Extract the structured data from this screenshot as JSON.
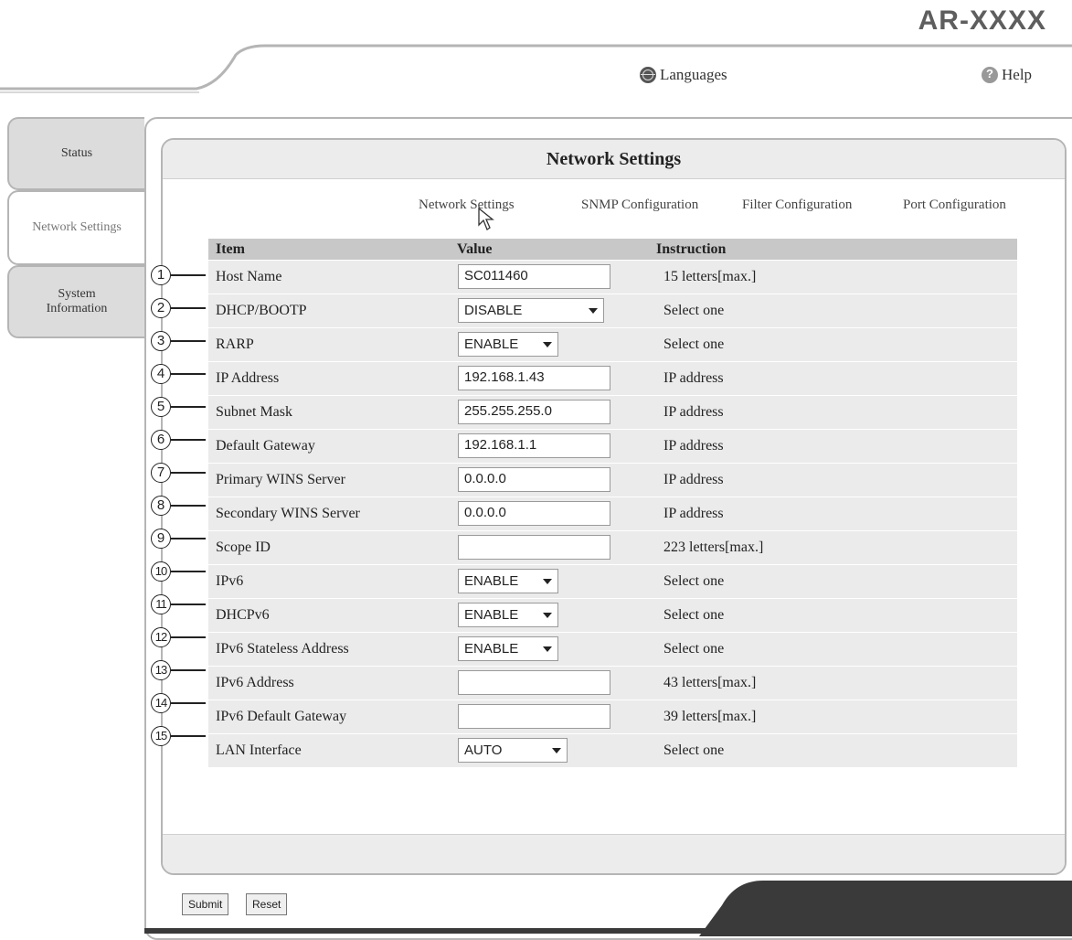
{
  "header": {
    "model": "AR-XXXX",
    "languages_label": "Languages",
    "help_label": "Help"
  },
  "tabs": [
    {
      "label": "Status"
    },
    {
      "label": "Network Settings"
    },
    {
      "label": "System Information"
    }
  ],
  "panel": {
    "title": "Network Settings",
    "subnav": [
      "Network Settings",
      "SNMP Configuration",
      "Filter Configuration",
      "Port Configuration"
    ]
  },
  "table": {
    "headers": {
      "item": "Item",
      "value": "Value",
      "instruction": "Instruction"
    },
    "rows": [
      {
        "num": "1",
        "item": "Host Name",
        "type": "input",
        "value": "SC011460",
        "instruction": "15 letters[max.]"
      },
      {
        "num": "2",
        "item": "DHCP/BOOTP",
        "type": "select",
        "value": "DISABLE",
        "instruction": "Select one"
      },
      {
        "num": "3",
        "item": "RARP",
        "type": "select",
        "value": "ENABLE",
        "instruction": "Select one"
      },
      {
        "num": "4",
        "item": "IP Address",
        "type": "input",
        "value": "192.168.1.43",
        "instruction": "IP address"
      },
      {
        "num": "5",
        "item": "Subnet Mask",
        "type": "input",
        "value": "255.255.255.0",
        "instruction": "IP address"
      },
      {
        "num": "6",
        "item": "Default Gateway",
        "type": "input",
        "value": "192.168.1.1",
        "instruction": "IP address"
      },
      {
        "num": "7",
        "item": "Primary WINS Server",
        "type": "input",
        "value": "0.0.0.0",
        "instruction": "IP address"
      },
      {
        "num": "8",
        "item": "Secondary WINS Server",
        "type": "input",
        "value": "0.0.0.0",
        "instruction": "IP address"
      },
      {
        "num": "9",
        "item": "Scope ID",
        "type": "input",
        "value": "",
        "instruction": "223 letters[max.]"
      },
      {
        "num": "10",
        "item": "IPv6",
        "type": "select",
        "value": "ENABLE",
        "instruction": "Select one"
      },
      {
        "num": "11",
        "item": "DHCPv6",
        "type": "select",
        "value": "ENABLE",
        "instruction": "Select one"
      },
      {
        "num": "12",
        "item": "IPv6 Stateless Address",
        "type": "select",
        "value": "ENABLE",
        "instruction": "Select one"
      },
      {
        "num": "13",
        "item": "IPv6 Address",
        "type": "input",
        "value": "",
        "instruction": "43 letters[max.]"
      },
      {
        "num": "14",
        "item": "IPv6 Default Gateway",
        "type": "input",
        "value": "",
        "instruction": "39 letters[max.]"
      },
      {
        "num": "15",
        "item": "LAN Interface",
        "type": "select",
        "value": "AUTO",
        "instruction": "Select one"
      }
    ]
  },
  "buttons": {
    "submit": "Submit",
    "reset": "Reset"
  },
  "colors": {
    "frame_border": "#b5b5b5",
    "header_band": "#c8c8c8",
    "row_bg": "#ebebeb",
    "footer_dark": "#3a3a3a"
  }
}
